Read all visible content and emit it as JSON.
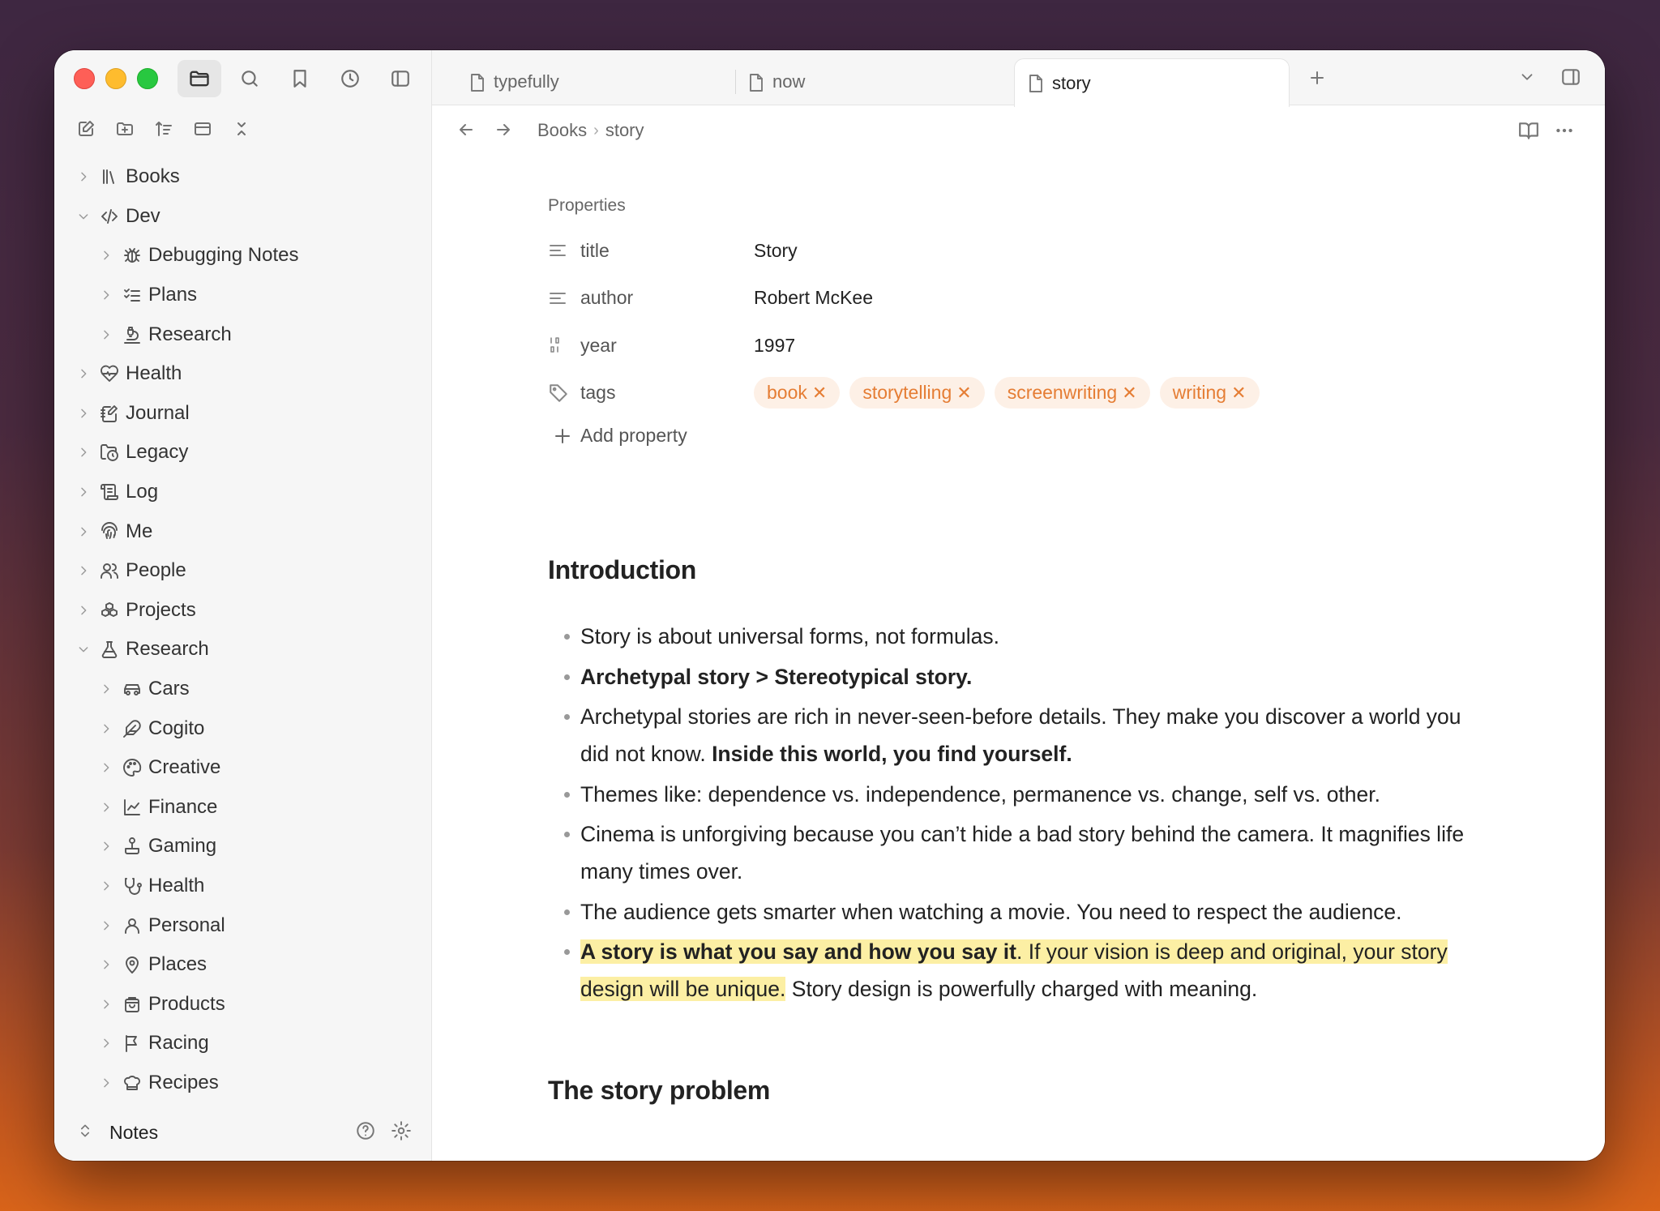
{
  "tabs": [
    {
      "label": "typefully",
      "active": false
    },
    {
      "label": "now",
      "active": false
    },
    {
      "label": "story",
      "active": true
    }
  ],
  "breadcrumb": [
    "Books",
    "story"
  ],
  "sidebar": {
    "items": [
      {
        "label": "Books",
        "icon": "library-icon",
        "level": 0,
        "expanded": false
      },
      {
        "label": "Dev",
        "icon": "code-icon",
        "level": 0,
        "expanded": true
      },
      {
        "label": "Debugging Notes",
        "icon": "bug-icon",
        "level": 1,
        "expanded": false
      },
      {
        "label": "Plans",
        "icon": "checklist-icon",
        "level": 1,
        "expanded": false
      },
      {
        "label": "Research",
        "icon": "microscope-icon",
        "level": 1,
        "expanded": false
      },
      {
        "label": "Health",
        "icon": "heart-pulse-icon",
        "level": 0,
        "expanded": false
      },
      {
        "label": "Journal",
        "icon": "notebook-pen-icon",
        "level": 0,
        "expanded": false
      },
      {
        "label": "Legacy",
        "icon": "folder-clock-icon",
        "level": 0,
        "expanded": false
      },
      {
        "label": "Log",
        "icon": "scroll-icon",
        "level": 0,
        "expanded": false
      },
      {
        "label": "Me",
        "icon": "fingerprint-icon",
        "level": 0,
        "expanded": false
      },
      {
        "label": "People",
        "icon": "users-icon",
        "level": 0,
        "expanded": false
      },
      {
        "label": "Projects",
        "icon": "boxes-icon",
        "level": 0,
        "expanded": false
      },
      {
        "label": "Research",
        "icon": "flask-icon",
        "level": 0,
        "expanded": true
      },
      {
        "label": "Cars",
        "icon": "car-icon",
        "level": 1,
        "expanded": false
      },
      {
        "label": "Cogito",
        "icon": "feather-icon",
        "level": 1,
        "expanded": false
      },
      {
        "label": "Creative",
        "icon": "palette-icon",
        "level": 1,
        "expanded": false
      },
      {
        "label": "Finance",
        "icon": "line-chart-icon",
        "level": 1,
        "expanded": false
      },
      {
        "label": "Gaming",
        "icon": "joystick-icon",
        "level": 1,
        "expanded": false
      },
      {
        "label": "Health",
        "icon": "stethoscope-icon",
        "level": 1,
        "expanded": false
      },
      {
        "label": "Personal",
        "icon": "user-icon",
        "level": 1,
        "expanded": false
      },
      {
        "label": "Places",
        "icon": "map-pin-icon",
        "level": 1,
        "expanded": false
      },
      {
        "label": "Products",
        "icon": "shopping-bag-icon",
        "level": 1,
        "expanded": false
      },
      {
        "label": "Racing",
        "icon": "flag-icon",
        "level": 1,
        "expanded": false
      },
      {
        "label": "Recipes",
        "icon": "chef-hat-icon",
        "level": 1,
        "expanded": false
      }
    ],
    "vault_name": "Notes"
  },
  "properties": {
    "heading": "Properties",
    "rows": [
      {
        "key": "title",
        "value": "Story",
        "icon": "text-icon"
      },
      {
        "key": "author",
        "value": "Robert McKee",
        "icon": "text-icon"
      },
      {
        "key": "year",
        "value": "1997",
        "icon": "number-icon"
      }
    ],
    "tags_key": "tags",
    "tags": [
      "book",
      "storytelling",
      "screenwriting",
      "writing"
    ],
    "add_label": "Add property"
  },
  "intro": {
    "heading": "Introduction",
    "b1": "Story is about universal forms, not formulas.",
    "b2": "Archetypal story > Stereotypical story.",
    "b3_a": "Archetypal stories are rich in never-seen-before details. They make you discover a world you did not know. ",
    "b3_b": "Inside this world, you find yourself.",
    "b4": "Themes like: dependence vs. independence, permanence vs. change, self vs. other.",
    "b5": "Cinema is unforgiving because you can’t hide a bad story behind the camera. It magnifies life many times over.",
    "b6": "The audience gets smarter when watching a movie. You need to respect the audience.",
    "b7_bold": "A story is what you say and how you say it",
    "b7_hl": ". If your vision is deep and original, your story design will be unique.",
    "b7_rest": " Story design is powerfully charged with meaning."
  },
  "next_heading": "The story problem",
  "colors": {
    "tag_text": "#e57d34",
    "tag_bg": "#fdf0e6",
    "highlight": "#fcefa4"
  }
}
